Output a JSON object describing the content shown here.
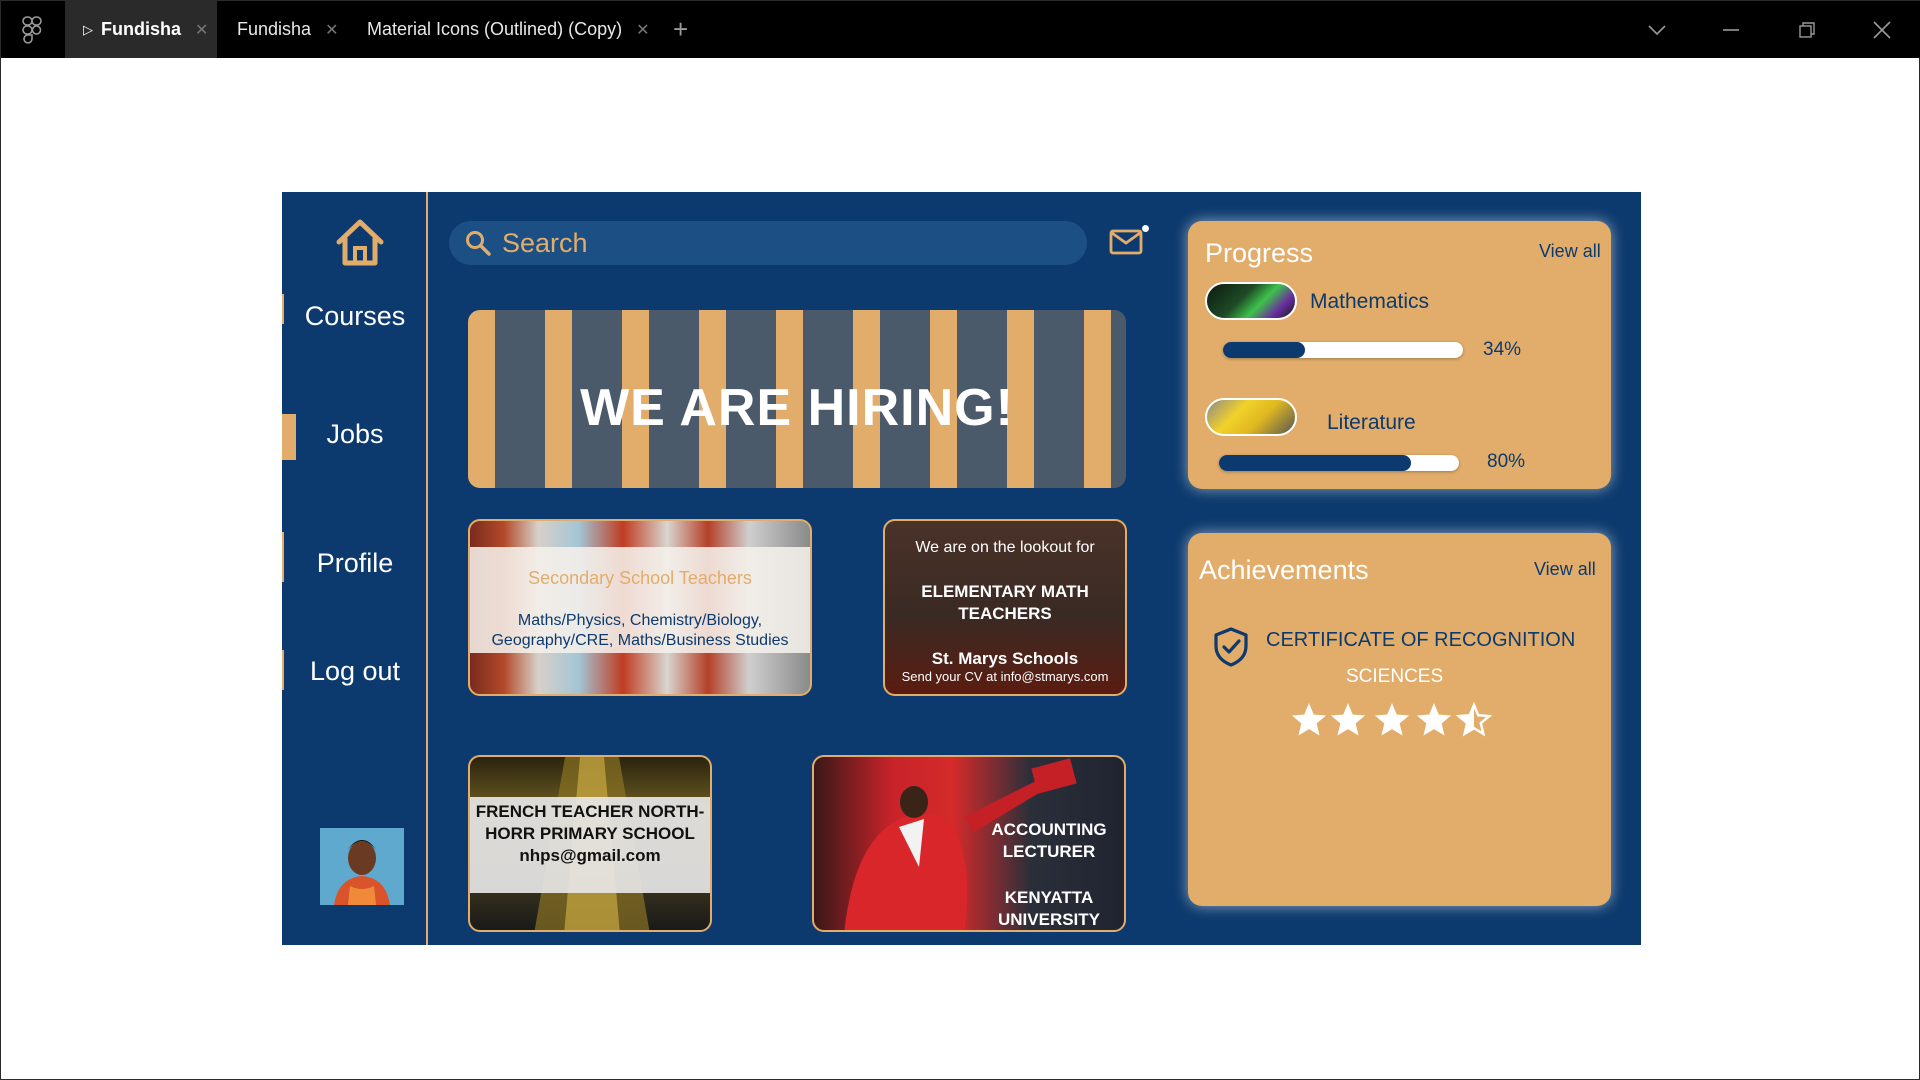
{
  "window": {
    "tabs": [
      {
        "label": "Fundisha",
        "active": true
      },
      {
        "label": "Fundisha",
        "active": false
      },
      {
        "label": "Material Icons (Outlined) (Copy)",
        "active": false
      }
    ]
  },
  "sidebar": {
    "items": [
      {
        "label": "Courses"
      },
      {
        "label": "Jobs",
        "selected": true
      },
      {
        "label": "Profile"
      },
      {
        "label": "Log out"
      }
    ]
  },
  "search": {
    "placeholder": "Search"
  },
  "banner": {
    "text": "WE ARE HIRING!"
  },
  "jobs": [
    {
      "title": "Secondary School Teachers",
      "subtitle": "Maths/Physics, Chemistry/Biology, Geography/CRE, Maths/Business Studies"
    },
    {
      "intro": "We are on the lookout for",
      "title": "ELEMENTARY MATH TEACHERS",
      "school": "St. Marys Schools",
      "contact": "Send your CV at info@stmarys.com"
    },
    {
      "text": "FRENCH TEACHER NORTH-HORR PRIMARY SCHOOL nhps@gmail.com"
    },
    {
      "title": "ACCOUNTING LECTURER",
      "school": "KENYATTA UNIVERSITY"
    }
  ],
  "progress": {
    "title": "Progress",
    "view_all": "View all",
    "subjects": [
      {
        "name": "Mathematics",
        "percent": 34,
        "percent_label": "34%"
      },
      {
        "name": "Literature",
        "percent": 80,
        "percent_label": "80%"
      }
    ]
  },
  "achievements": {
    "title": "Achievements",
    "view_all": "View all",
    "certificate": "CERTIFICATE OF RECOGNITION",
    "field": "SCIENCES",
    "stars": 4.5
  },
  "colors": {
    "navy": "#0c3a6e",
    "gold": "#e2ad6a"
  }
}
